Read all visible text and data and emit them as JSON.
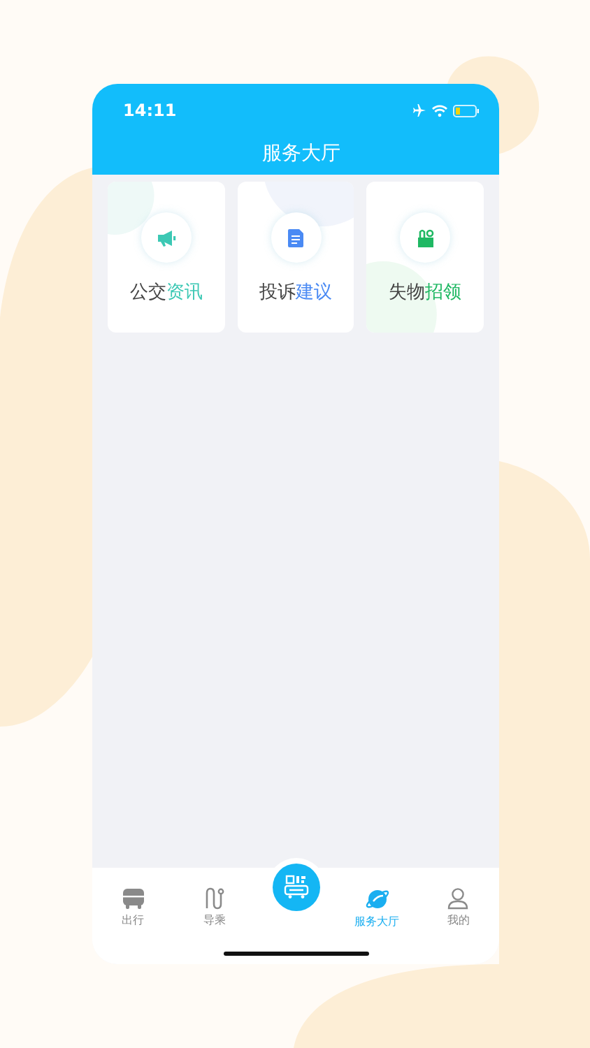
{
  "status_bar": {
    "time": "14:11"
  },
  "header": {
    "title": "服务大厅"
  },
  "cards": [
    {
      "title_plain": "公交",
      "title_accent": "资讯",
      "color": "#3cc8b4",
      "kind": "megaphone"
    },
    {
      "title_plain": "投诉",
      "title_accent": "建议",
      "color": "#4a8af4",
      "kind": "document"
    },
    {
      "title_plain": "失物",
      "title_accent": "招领",
      "color": "#1fb863",
      "kind": "box"
    }
  ],
  "tab_bar": [
    {
      "kind": "bus",
      "label": "出行",
      "selected": false
    },
    {
      "kind": "route",
      "label": "导乘",
      "selected": false
    },
    {
      "kind": "scan",
      "selected": false
    },
    {
      "kind": "planet",
      "label": "服务大厅",
      "selected": true
    },
    {
      "kind": "person",
      "label": "我的",
      "selected": false
    }
  ]
}
